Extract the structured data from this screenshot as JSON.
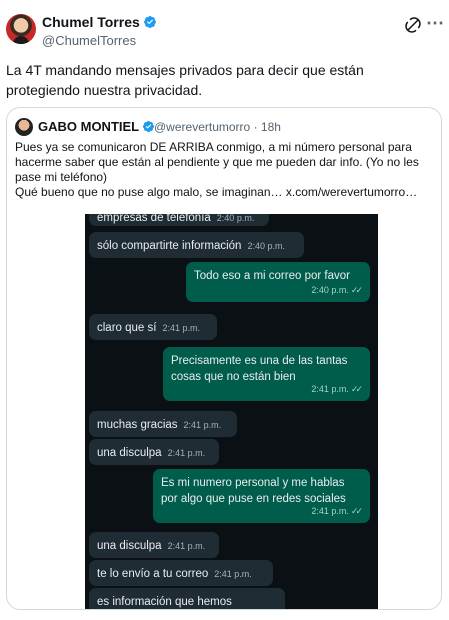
{
  "tweet": {
    "author_name": "Chumel Torres",
    "author_handle": "@ChumelTorres",
    "text": "La 4T mandando mensajes privados para decir que están protegiendo nuestra privacidad."
  },
  "quote": {
    "author_name": "GABO MONTIEL",
    "author_handle": "@werevertumorro",
    "time_sep": "·",
    "time": "18h",
    "text_line1": "Pues ya se comunicaron DE ARRIBA conmigo, a mi número personal para hacerme saber que están al pendiente y que me pueden dar info. (Yo no les pase mi teléfono)",
    "text_line2": "Qué bueno que no puse algo malo, se imaginan…",
    "link": "x.com/werevertumorro…"
  },
  "chat": {
    "messages": [
      {
        "dir": "in",
        "text": "empresas de telefonía",
        "time": "2:40 p.m."
      },
      {
        "dir": "in",
        "text": "sólo compartirte información",
        "time": "2:40 p.m."
      },
      {
        "dir": "out",
        "text": "Todo eso a mi correo por favor",
        "time": "2:40 p.m."
      },
      {
        "dir": "in",
        "text": "claro que sí",
        "time": "2:41 p.m."
      },
      {
        "dir": "out",
        "text": "Precisamente es una de las tantas cosas que no están bien",
        "time": "2:41 p.m."
      },
      {
        "dir": "in",
        "text": "muchas gracias",
        "time": "2:41 p.m."
      },
      {
        "dir": "in",
        "text": "una disculpa",
        "time": "2:41 p.m."
      },
      {
        "dir": "out",
        "text": "Es mi numero personal y me hablas por algo que puse en redes sociales",
        "time": "2:41 p.m."
      },
      {
        "dir": "in",
        "text": "una disculpa",
        "time": "2:41 p.m."
      },
      {
        "dir": "in",
        "text": "te lo envío a tu correo",
        "time": "2:41 p.m."
      },
      {
        "dir": "in",
        "text": "es información que hemos compartido a los medios de",
        "time": ""
      }
    ],
    "read_ticks": "✓✓"
  },
  "icons": {
    "verified": "verified-badge-icon",
    "grok": "grok-icon",
    "more": "more-icon"
  },
  "colors": {
    "verified_blue": "#1d9bf0",
    "chat_background": "#0b1014",
    "incoming_bubble": "#1f2c33",
    "outgoing_bubble": "#005c4b"
  }
}
